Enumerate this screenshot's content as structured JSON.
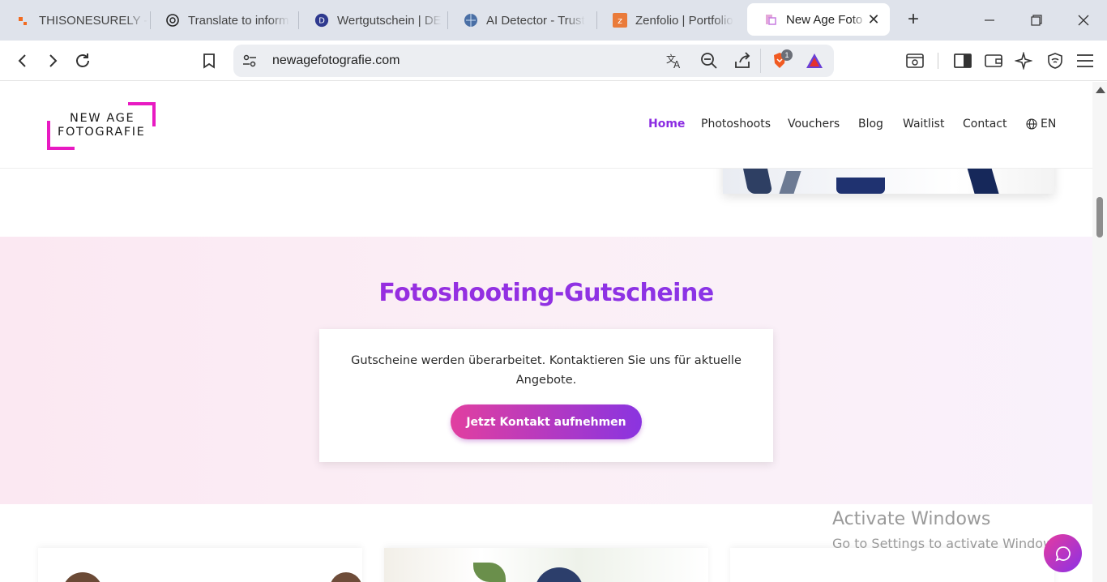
{
  "browser": {
    "tabs": [
      {
        "label": "THISONESURELY -",
        "icon": "asana-icon"
      },
      {
        "label": "Translate to inform",
        "icon": "chatgpt-icon"
      },
      {
        "label": "Wertgutschein | DE",
        "icon": "d-logo-icon"
      },
      {
        "label": "AI Detector - Trust",
        "icon": "globe-brain-icon"
      },
      {
        "label": "Zenfolio | Portfolio",
        "icon": "zenfolio-icon"
      },
      {
        "label": "New Age Foto",
        "icon": "newage-favicon",
        "active": true
      }
    ],
    "url": "newagefotografie.com",
    "brave_badge": "1"
  },
  "site": {
    "logo": {
      "line1": "NEW AGE",
      "line2": "FOTOGRAFIE"
    },
    "nav": [
      "Home",
      "Photoshoots",
      "Vouchers",
      "Blog",
      "Waitlist",
      "Contact"
    ],
    "active_nav": "Home",
    "language": "EN"
  },
  "voucher_section": {
    "title": "Fotoshooting-Gutscheine",
    "notice": "Gutscheine werden überarbeitet. Kontaktieren Sie uns für aktuelle Angebote.",
    "cta_label": "Jetzt Kontakt aufnehmen"
  },
  "watermark": {
    "line1": "Activate Windows",
    "line2": "Go to Settings to activate Windows."
  },
  "colors": {
    "accent_pink": "#e81ac2",
    "accent_purple": "#8b2be2",
    "section_bg": "#fbe8f2"
  }
}
